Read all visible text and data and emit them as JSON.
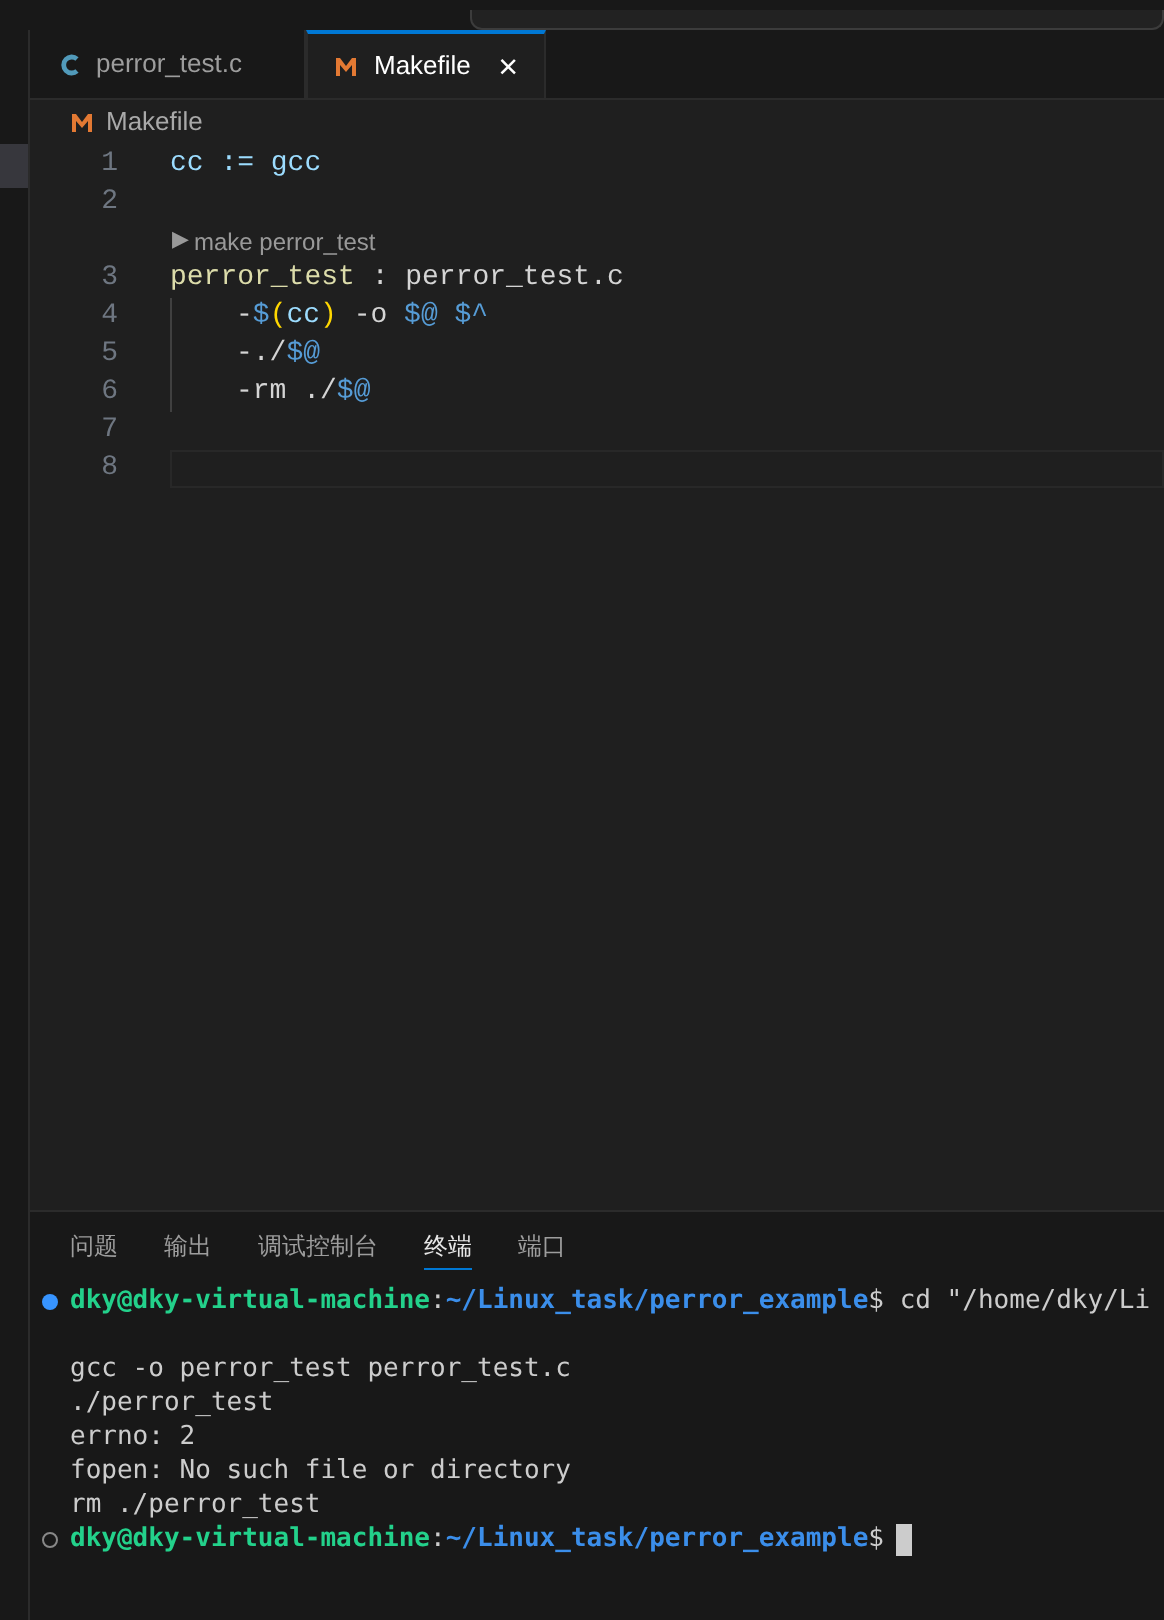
{
  "tabs": [
    {
      "label": "perror_test.c",
      "kind": "c",
      "selected": false
    },
    {
      "label": "Makefile",
      "kind": "make",
      "selected": true,
      "close": "×"
    }
  ],
  "breadcrumb": {
    "label": "Makefile"
  },
  "code": [
    {
      "number": "1",
      "tokens": [
        {
          "kind": "var",
          "text": "cc := gcc"
        }
      ]
    },
    {
      "number": "2"
    },
    {
      "number": "3",
      "codelens": {
        "icon": "▶",
        "label": "make perror_test"
      },
      "tokens": [
        {
          "kind": "target",
          "text": "perror_test"
        },
        {
          "kind": "plain",
          "text": " : perror_test.c"
        }
      ]
    },
    {
      "number": "4",
      "indent": true,
      "tokens": [
        {
          "kind": "dash",
          "text": "-"
        },
        {
          "kind": "auto",
          "text": "$"
        },
        {
          "kind": "paren",
          "text": "("
        },
        {
          "kind": "var",
          "text": "cc"
        },
        {
          "kind": "paren",
          "text": ")"
        },
        {
          "kind": "plain",
          "text": " -o "
        },
        {
          "kind": "auto",
          "text": "$@ $^"
        }
      ]
    },
    {
      "number": "5",
      "indent": true,
      "tokens": [
        {
          "kind": "dash",
          "text": "-"
        },
        {
          "kind": "plain",
          "text": "./"
        },
        {
          "kind": "auto",
          "text": "$@"
        }
      ]
    },
    {
      "number": "6",
      "indent": true,
      "tokens": [
        {
          "kind": "dash",
          "text": "-"
        },
        {
          "kind": "plain",
          "text": "rm ./"
        },
        {
          "kind": "auto",
          "text": "$@"
        }
      ]
    },
    {
      "number": "7"
    },
    {
      "number": "8",
      "current": true
    }
  ],
  "panel_tabs": [
    {
      "label": "问题",
      "selected": false
    },
    {
      "label": "输出",
      "selected": false
    },
    {
      "label": "调试控制台",
      "selected": false
    },
    {
      "label": "终端",
      "selected": true
    },
    {
      "label": "端口",
      "selected": false
    }
  ],
  "terminal": [
    {
      "kind": "prompt",
      "finished": true,
      "user": "dky@dky-virtual-machine",
      "sep": ":",
      "path": "~/Linux_task/perror_example",
      "dollar": "$",
      "command": " cd \"/home/dky/Li"
    },
    {
      "kind": "blank"
    },
    {
      "kind": "output",
      "text": "gcc -o perror_test perror_test.c"
    },
    {
      "kind": "output",
      "text": "./perror_test"
    },
    {
      "kind": "output",
      "text": "errno: 2"
    },
    {
      "kind": "output",
      "text": "fopen: No such file or directory"
    },
    {
      "kind": "output",
      "text": "rm ./perror_test"
    },
    {
      "kind": "prompt",
      "finished": false,
      "user": "dky@dky-virtual-machine",
      "sep": ":",
      "path": "~/Linux_task/perror_example",
      "dollar": "$",
      "cursor": true
    }
  ]
}
